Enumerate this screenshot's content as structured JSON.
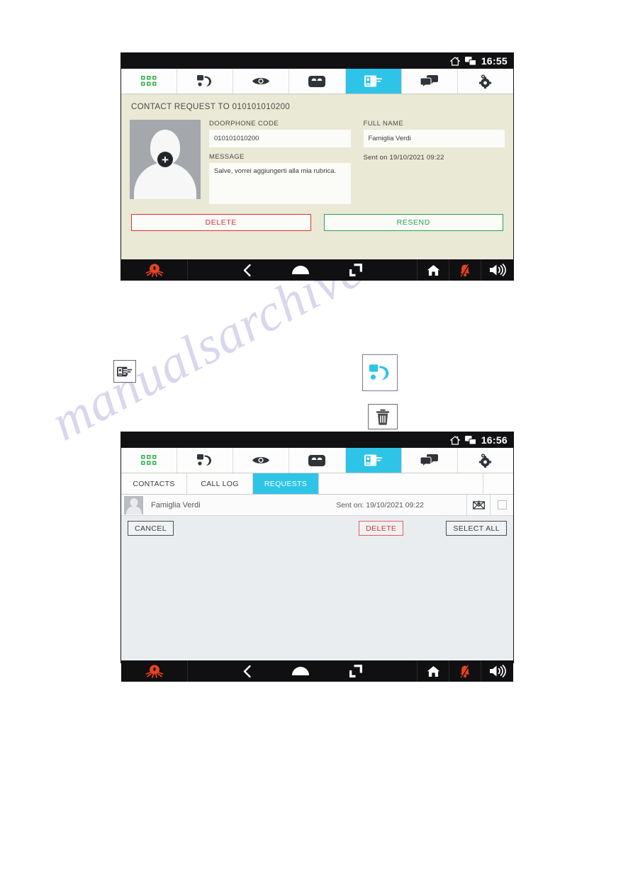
{
  "document": {
    "watermark_text": "manualsarchive.com"
  },
  "screen_one": {
    "status_bar": {
      "time": "16:55",
      "icons": [
        "home-icon",
        "screens-icon"
      ]
    },
    "tabs": [
      {
        "name": "keypad",
        "icon": "keypad-grid-icon",
        "active": false
      },
      {
        "name": "calls",
        "icon": "phone-handset-icon",
        "active": false
      },
      {
        "name": "surveillance",
        "icon": "eye-icon",
        "active": false
      },
      {
        "name": "voicemail",
        "icon": "answering-machine-icon",
        "active": false
      },
      {
        "name": "contacts",
        "icon": "contact-card-icon",
        "active": true
      },
      {
        "name": "messages",
        "icon": "chat-bubbles-icon",
        "active": false
      },
      {
        "name": "settings",
        "icon": "gear-icon",
        "active": false
      }
    ],
    "heading": "CONTACT REQUEST TO 010101010200",
    "avatar": {
      "icon": "avatar-add-icon"
    },
    "fields": {
      "doorphone_code_label": "DOORPHONE CODE",
      "doorphone_code_value": "010101010200",
      "full_name_label": "FULL NAME",
      "full_name_value": "Famiglia Verdi",
      "message_label": "MESSAGE",
      "message_value": "Salve, vorrei aggiungerti alla mia rubrica.",
      "sent_note": "Sent on 19/10/2021 09:22"
    },
    "buttons": {
      "delete": "DELETE",
      "resend": "RESEND"
    },
    "nav_bar": {
      "logo": "octopus-logo-icon",
      "back": "back-chevron-icon",
      "home": "home-arch-icon",
      "recents": "recents-icon",
      "house": "house-icon",
      "mute": "bell-muted-icon",
      "volume": "speaker-volume-icon"
    },
    "colors": {
      "accent": "#2ec4e8",
      "content_bg": "#e9e9d6",
      "delete": "#e03131",
      "resend": "#2aa14f",
      "logo": "#e8431f"
    }
  },
  "inline_icons": [
    {
      "name": "contact-card-icon",
      "label": "contacts tab icon"
    },
    {
      "name": "phone-handset-icon",
      "label": "calls tab icon"
    },
    {
      "name": "trash-icon",
      "label": "delete icon"
    }
  ],
  "screen_two": {
    "status_bar": {
      "time": "16:56",
      "icons": [
        "home-icon",
        "screens-icon"
      ]
    },
    "tabs": [
      {
        "name": "keypad",
        "icon": "keypad-grid-icon",
        "active": false
      },
      {
        "name": "calls",
        "icon": "phone-handset-icon",
        "active": false
      },
      {
        "name": "surveillance",
        "icon": "eye-icon",
        "active": false
      },
      {
        "name": "voicemail",
        "icon": "answering-machine-icon",
        "active": false
      },
      {
        "name": "contacts",
        "icon": "contact-card-icon",
        "active": true
      },
      {
        "name": "messages",
        "icon": "chat-bubbles-icon",
        "active": false
      },
      {
        "name": "settings",
        "icon": "gear-icon",
        "active": false
      }
    ],
    "sub_tabs": [
      {
        "label": "CONTACTS",
        "active": false
      },
      {
        "label": "CALL LOG",
        "active": false
      },
      {
        "label": "REQUESTS",
        "active": true
      }
    ],
    "list": [
      {
        "name": "Famiglia Verdi",
        "sent": "Sent on: 19/10/2021 09:22",
        "status_icon": "sent-envelope-icon",
        "checked": false
      }
    ],
    "buttons": {
      "cancel": "CANCEL",
      "delete": "DELETE",
      "select_all": "SELECT ALL"
    },
    "nav_bar": {
      "logo": "octopus-logo-icon",
      "back": "back-chevron-icon",
      "home": "home-arch-icon",
      "recents": "recents-icon",
      "house": "house-icon",
      "mute": "bell-muted-icon",
      "volume": "speaker-volume-icon"
    },
    "colors": {
      "accent": "#2ec4e8",
      "content_bg": "#eaedf0",
      "delete": "#e03131"
    }
  }
}
